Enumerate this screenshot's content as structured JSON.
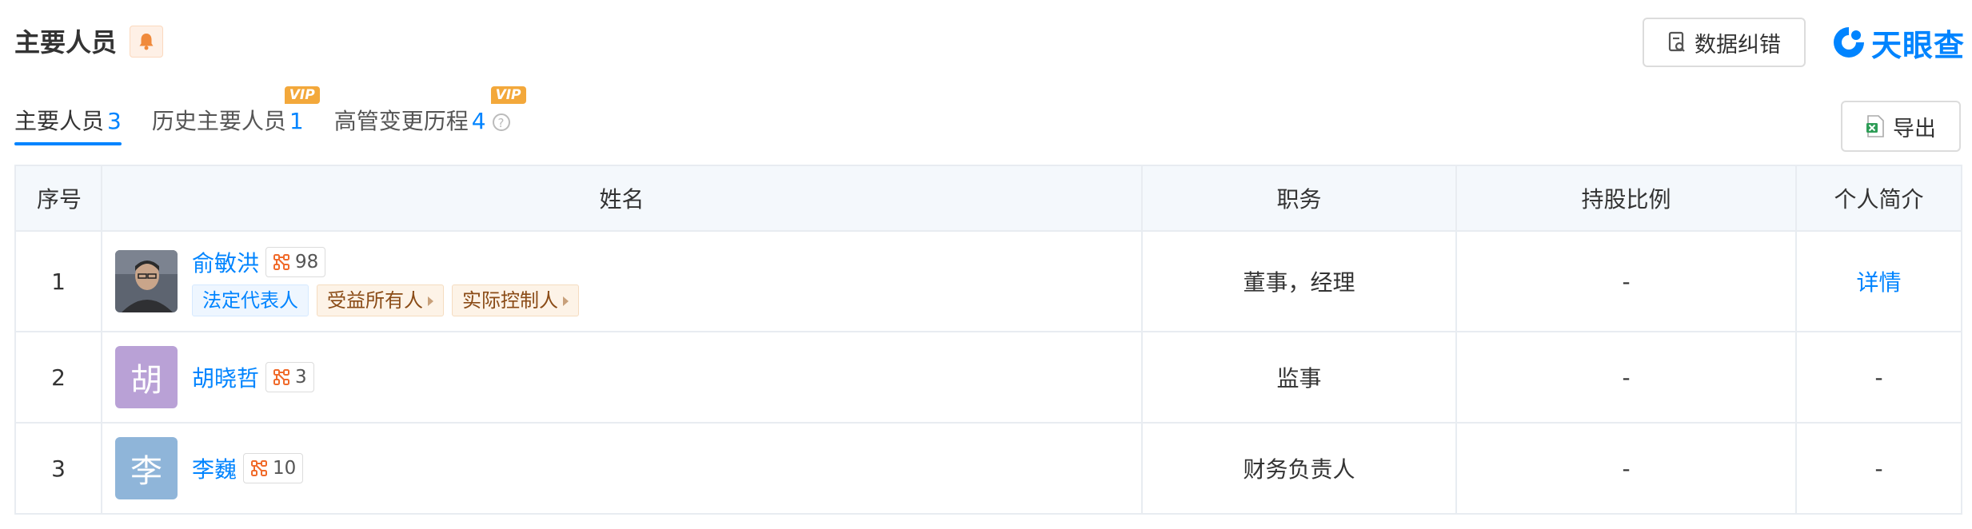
{
  "header": {
    "title": "主要人员",
    "error_button": "数据纠错",
    "brand": "天眼查"
  },
  "tabs": [
    {
      "label": "主要人员",
      "count": "3",
      "active": true,
      "vip": false
    },
    {
      "label": "历史主要人员",
      "count": "1",
      "active": false,
      "vip": true,
      "vip_label": "VIP"
    },
    {
      "label": "高管变更历程",
      "count": "4",
      "active": false,
      "vip": true,
      "vip_label": "VIP",
      "help": "?"
    }
  ],
  "export_button": "导出",
  "table": {
    "headers": [
      "序号",
      "姓名",
      "职务",
      "持股比例",
      "个人简介"
    ],
    "rows": [
      {
        "index": "1",
        "name": "俞敏洪",
        "relation_count": "98",
        "tags": [
          "法定代表人",
          "受益所有人",
          "实际控制人"
        ],
        "position": "董事，经理",
        "shareholding": "-",
        "profile": "详情",
        "avatar_type": "photo"
      },
      {
        "index": "2",
        "name": "胡晓哲",
        "avatar_char": "胡",
        "avatar_color": "#b9a1d6",
        "relation_count": "3",
        "position": "监事",
        "shareholding": "-",
        "profile": "-"
      },
      {
        "index": "3",
        "name": "李巍",
        "avatar_char": "李",
        "avatar_color": "#8fb5d9",
        "relation_count": "10",
        "position": "财务负责人",
        "shareholding": "-",
        "profile": "-"
      }
    ]
  },
  "colors": {
    "accent": "#0084ff",
    "vip": "#f3a83b",
    "bell": "#f08a3c"
  }
}
